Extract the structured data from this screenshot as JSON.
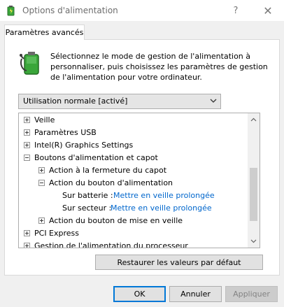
{
  "window": {
    "title": "Options d'alimentation",
    "help_label": "?",
    "close_label": "✕"
  },
  "tab": {
    "label": "Paramètres avancés"
  },
  "description": "Sélectionnez le mode de gestion de l'alimentation à personnaliser, puis choisissez les paramètres de gestion de l'alimentation pour votre ordinateur.",
  "plan_select": {
    "value": "Utilisation normale [activé]"
  },
  "tree": {
    "items": [
      {
        "label": "Veille",
        "expander": "plus"
      },
      {
        "label": "Paramètres USB",
        "expander": "plus"
      },
      {
        "label": "Intel(R) Graphics Settings",
        "expander": "plus"
      },
      {
        "label": "Boutons d'alimentation et capot",
        "expander": "minus"
      },
      {
        "label": "Action à la fermeture du capot",
        "expander": "plus"
      },
      {
        "label": "Action du bouton d'alimentation",
        "expander": "minus"
      },
      {
        "label": "Sur batterie :",
        "value": "Mettre en veille prolongée"
      },
      {
        "label": "Sur secteur :",
        "value": "Mettre en veille prolongée"
      },
      {
        "label": "Action du bouton de mise en veille",
        "expander": "plus"
      },
      {
        "label": "PCI Express",
        "expander": "plus"
      },
      {
        "label": "Gestion de l'alimentation du processeur",
        "expander": "plus"
      }
    ]
  },
  "buttons": {
    "restore": "Restaurer les valeurs par défaut",
    "ok": "OK",
    "cancel": "Annuler",
    "apply": "Appliquer"
  },
  "colors": {
    "link": "#0066cc",
    "accent": "#0078d7",
    "battery_green": "#3aa63a"
  }
}
